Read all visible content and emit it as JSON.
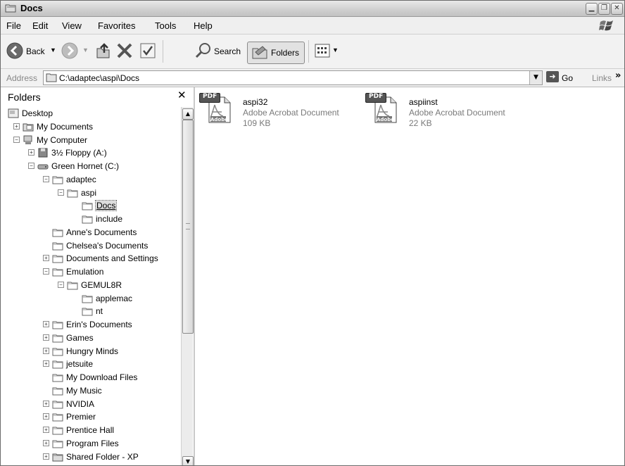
{
  "window": {
    "title": "Docs"
  },
  "menu": [
    "File",
    "Edit",
    "View",
    "Favorites",
    "Tools",
    "Help"
  ],
  "toolbar": {
    "back_label": "Back",
    "search_label": "Search",
    "folders_label": "Folders"
  },
  "address": {
    "label": "Address",
    "path": "C:\\adaptec\\aspi\\Docs",
    "go_label": "Go",
    "links_label": "Links"
  },
  "folders_pane": {
    "title": "Folders",
    "tree": [
      {
        "label": "Desktop",
        "expander": "",
        "icon": "desktop"
      },
      {
        "label": "My Documents",
        "expander": "+",
        "icon": "mydocs"
      },
      {
        "label": "My Computer",
        "expander": "−",
        "icon": "computer"
      },
      {
        "label": "3½ Floppy (A:)",
        "expander": "+",
        "icon": "floppy"
      },
      {
        "label": "Green Hornet (C:)",
        "expander": "−",
        "icon": "drive"
      },
      {
        "label": "adaptec",
        "expander": "−",
        "icon": "folder"
      },
      {
        "label": "aspi",
        "expander": "−",
        "icon": "folder"
      },
      {
        "label": "Docs",
        "expander": "",
        "icon": "folder",
        "selected": true
      },
      {
        "label": "include",
        "expander": "",
        "icon": "folder"
      },
      {
        "label": "Anne's Documents",
        "expander": "",
        "icon": "folder"
      },
      {
        "label": "Chelsea's Documents",
        "expander": "",
        "icon": "folder"
      },
      {
        "label": "Documents and Settings",
        "expander": "+",
        "icon": "folder"
      },
      {
        "label": "Emulation",
        "expander": "−",
        "icon": "folder"
      },
      {
        "label": "GEMUL8R",
        "expander": "−",
        "icon": "folder"
      },
      {
        "label": "applemac",
        "expander": "",
        "icon": "folder"
      },
      {
        "label": "nt",
        "expander": "",
        "icon": "folder"
      },
      {
        "label": "Erin's Documents",
        "expander": "+",
        "icon": "folder"
      },
      {
        "label": "Games",
        "expander": "+",
        "icon": "folder"
      },
      {
        "label": "Hungry Minds",
        "expander": "+",
        "icon": "folder"
      },
      {
        "label": "jetsuite",
        "expander": "+",
        "icon": "folder"
      },
      {
        "label": "My Download Files",
        "expander": "",
        "icon": "folder"
      },
      {
        "label": "My Music",
        "expander": "",
        "icon": "folder"
      },
      {
        "label": "NVIDIA",
        "expander": "+",
        "icon": "folder"
      },
      {
        "label": "Premier",
        "expander": "+",
        "icon": "folder"
      },
      {
        "label": "Prentice Hall",
        "expander": "+",
        "icon": "folder"
      },
      {
        "label": "Program Files",
        "expander": "+",
        "icon": "folder"
      },
      {
        "label": "Shared Folder - XP",
        "expander": "+",
        "icon": "shared-folder"
      }
    ]
  },
  "files": [
    {
      "name": "aspi32",
      "type": "Adobe Acrobat Document",
      "size": "109 KB",
      "badge": "PDF",
      "brand": "Adobe"
    },
    {
      "name": "aspiinst",
      "type": "Adobe Acrobat Document",
      "size": "22 KB",
      "badge": "PDF",
      "brand": "Adobe"
    }
  ]
}
